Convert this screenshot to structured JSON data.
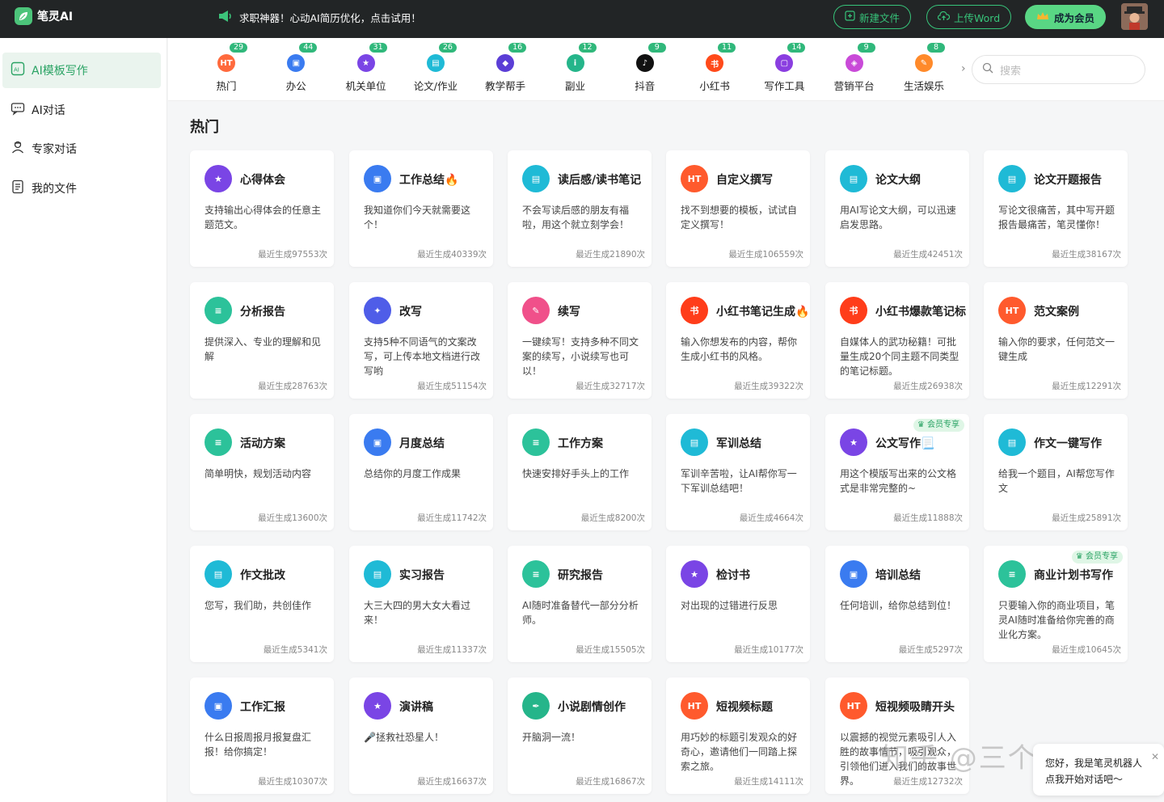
{
  "header": {
    "app_name": "笔灵AI",
    "promo_text": "求职神器！心动AI简历优化，点击试用！",
    "new_file_label": "新建文件",
    "upload_word_label": "上传Word",
    "member_label": "成为会员"
  },
  "sidebar": {
    "items": [
      {
        "label": "AI模板写作",
        "icon": "ai-template-icon",
        "active": true
      },
      {
        "label": "AI对话",
        "icon": "chat-icon",
        "active": false
      },
      {
        "label": "专家对话",
        "icon": "expert-icon",
        "active": false
      },
      {
        "label": "我的文件",
        "icon": "file-icon",
        "active": false
      }
    ]
  },
  "categories": [
    {
      "label": "热门",
      "count": "29",
      "color": "#ff6a3d",
      "glyph": "HT"
    },
    {
      "label": "办公",
      "count": "44",
      "color": "#3a7bf0",
      "glyph": "▣"
    },
    {
      "label": "机关单位",
      "count": "31",
      "color": "#7a45e5",
      "glyph": "★"
    },
    {
      "label": "论文/作业",
      "count": "26",
      "color": "#1fbad6",
      "glyph": "▤"
    },
    {
      "label": "教学帮手",
      "count": "16",
      "color": "#5b3ed6",
      "glyph": "◆"
    },
    {
      "label": "副业",
      "count": "12",
      "color": "#25b58a",
      "glyph": "i"
    },
    {
      "label": "抖音",
      "count": "9",
      "color": "#111111",
      "glyph": "♪"
    },
    {
      "label": "小红书",
      "count": "11",
      "color": "#ff4a1a",
      "glyph": "书"
    },
    {
      "label": "写作工具",
      "count": "14",
      "color": "#8a3ee0",
      "glyph": "▢"
    },
    {
      "label": "营销平台",
      "count": "9",
      "color": "#c94ad8",
      "glyph": "◈"
    },
    {
      "label": "生活娱乐",
      "count": "8",
      "color": "#ff8a2a",
      "glyph": "✎"
    }
  ],
  "search": {
    "placeholder": "搜索"
  },
  "section_title": "热门",
  "cards": [
    {
      "title": "心得体会",
      "desc": "支持输出心得体会的任意主题范文。",
      "count": "最近生成97553次",
      "color": "#7a45e5",
      "glyph": "★",
      "vip": ""
    },
    {
      "title": "工作总结🔥",
      "desc": "我知道你们今天就需要这个！",
      "count": "最近生成40339次",
      "color": "#3a7bf0",
      "glyph": "▣",
      "vip": ""
    },
    {
      "title": "读后感/读书笔记",
      "desc": "不会写读后感的朋友有福啦，用这个就立刻学会！",
      "count": "最近生成21890次",
      "color": "#1fbad6",
      "glyph": "▤",
      "vip": ""
    },
    {
      "title": "自定义撰写",
      "desc": "找不到想要的模板，试试自定义撰写！",
      "count": "最近生成106559次",
      "color": "#ff5a2d",
      "glyph": "HT",
      "vip": ""
    },
    {
      "title": "论文大纲",
      "desc": "用AI写论文大纲，可以迅速启发思路。",
      "count": "最近生成42451次",
      "color": "#1fbad6",
      "glyph": "▤",
      "vip": ""
    },
    {
      "title": "论文开题报告",
      "desc": "写论文很痛苦，其中写开题报告最痛苦，笔灵懂你！",
      "count": "最近生成38167次",
      "color": "#1fbad6",
      "glyph": "▤",
      "vip": ""
    },
    {
      "title": "分析报告",
      "desc": "提供深入、专业的理解和见解",
      "count": "最近生成28763次",
      "color": "#2cc29a",
      "glyph": "≡",
      "vip": ""
    },
    {
      "title": "改写",
      "desc": "支持5种不同语气的文案改写，可上传本地文档进行改写哟",
      "count": "最近生成51154次",
      "color": "#4f5de8",
      "glyph": "✦",
      "vip": ""
    },
    {
      "title": "续写",
      "desc": "一键续写！支持多种不同文案的续写，小说续写也可以！",
      "count": "最近生成32717次",
      "color": "#f0508a",
      "glyph": "✎",
      "vip": ""
    },
    {
      "title": "小红书笔记生成🔥",
      "desc": "输入你想发布的内容，帮你生成小红书的风格。",
      "count": "最近生成39322次",
      "color": "#ff3d1a",
      "glyph": "书",
      "vip": ""
    },
    {
      "title": "小红书爆款笔记标",
      "desc": "自媒体人的武功秘籍！可批量生成20个同主题不同类型的笔记标题。",
      "count": "最近生成26938次",
      "color": "#ff3d1a",
      "glyph": "书",
      "vip": ""
    },
    {
      "title": "范文案例",
      "desc": "输入你的要求，任何范文一键生成",
      "count": "最近生成12291次",
      "color": "#ff5a2d",
      "glyph": "HT",
      "vip": ""
    },
    {
      "title": "活动方案",
      "desc": "简单明快，规划活动内容",
      "count": "最近生成13600次",
      "color": "#2cc29a",
      "glyph": "≡",
      "vip": ""
    },
    {
      "title": "月度总结",
      "desc": "总结你的月度工作成果",
      "count": "最近生成11742次",
      "color": "#3a7bf0",
      "glyph": "▣",
      "vip": ""
    },
    {
      "title": "工作方案",
      "desc": "快速安排好手头上的工作",
      "count": "最近生成8200次",
      "color": "#2cc29a",
      "glyph": "≡",
      "vip": ""
    },
    {
      "title": "军训总结",
      "desc": "军训辛苦啦，让AI帮你写一下军训总结吧！",
      "count": "最近生成4664次",
      "color": "#1fbad6",
      "glyph": "▤",
      "vip": ""
    },
    {
      "title": "公文写作📃",
      "desc": "用这个模版写出来的公文格式是非常完整的~",
      "count": "最近生成11888次",
      "color": "#7a45e5",
      "glyph": "★",
      "vip": "会员专享"
    },
    {
      "title": "作文一键写作",
      "desc": "给我一个题目，AI帮您写作文",
      "count": "最近生成25891次",
      "color": "#1fbad6",
      "glyph": "▤",
      "vip": ""
    },
    {
      "title": "作文批改",
      "desc": "您写，我们助，共创佳作",
      "count": "最近生成5341次",
      "color": "#1fbad6",
      "glyph": "▤",
      "vip": ""
    },
    {
      "title": "实习报告",
      "desc": "大三大四的男大女大看过来！",
      "count": "最近生成11337次",
      "color": "#1fbad6",
      "glyph": "▤",
      "vip": ""
    },
    {
      "title": "研究报告",
      "desc": "AI随时准备替代一部分分析师。",
      "count": "最近生成15505次",
      "color": "#2cc29a",
      "glyph": "≡",
      "vip": ""
    },
    {
      "title": "检讨书",
      "desc": "对出现的过错进行反思",
      "count": "最近生成10177次",
      "color": "#7a45e5",
      "glyph": "★",
      "vip": ""
    },
    {
      "title": "培训总结",
      "desc": "任何培训，给你总结到位！",
      "count": "最近生成5297次",
      "color": "#3a7bf0",
      "glyph": "▣",
      "vip": ""
    },
    {
      "title": "商业计划书写作",
      "desc": "只要输入你的商业项目，笔灵AI随时准备给你完善的商业化方案。",
      "count": "最近生成10645次",
      "color": "#2cc29a",
      "glyph": "≡",
      "vip": "会员专享"
    },
    {
      "title": "工作汇报",
      "desc": "什么日报周报月报复盘汇报！给你搞定！",
      "count": "最近生成10307次",
      "color": "#3a7bf0",
      "glyph": "▣",
      "vip": ""
    },
    {
      "title": "演讲稿",
      "desc": "🎤拯救社恐星人！",
      "count": "最近生成16637次",
      "color": "#7a45e5",
      "glyph": "★",
      "vip": ""
    },
    {
      "title": "小说剧情创作",
      "desc": "开脑洞一流！",
      "count": "最近生成16867次",
      "color": "#25b58a",
      "glyph": "✒",
      "vip": ""
    },
    {
      "title": "短视频标题",
      "desc": "用巧妙的标题引发观众的好奇心，邀请他们一同踏上探索之旅。",
      "count": "最近生成14111次",
      "color": "#ff5a2d",
      "glyph": "HT",
      "vip": ""
    },
    {
      "title": "短视频吸睛开头",
      "desc": "以震撼的视觉元素吸引人入胜的故事情节，吸引观众，引领他们进入我们的故事世界。",
      "count": "最近生成12732次",
      "color": "#ff5a2d",
      "glyph": "HT",
      "vip": ""
    }
  ],
  "watermark": "知乎 @三个工具",
  "chat_popup": {
    "line1": "您好，我是笔灵机器人",
    "line2": "点我开始对话吧～"
  }
}
